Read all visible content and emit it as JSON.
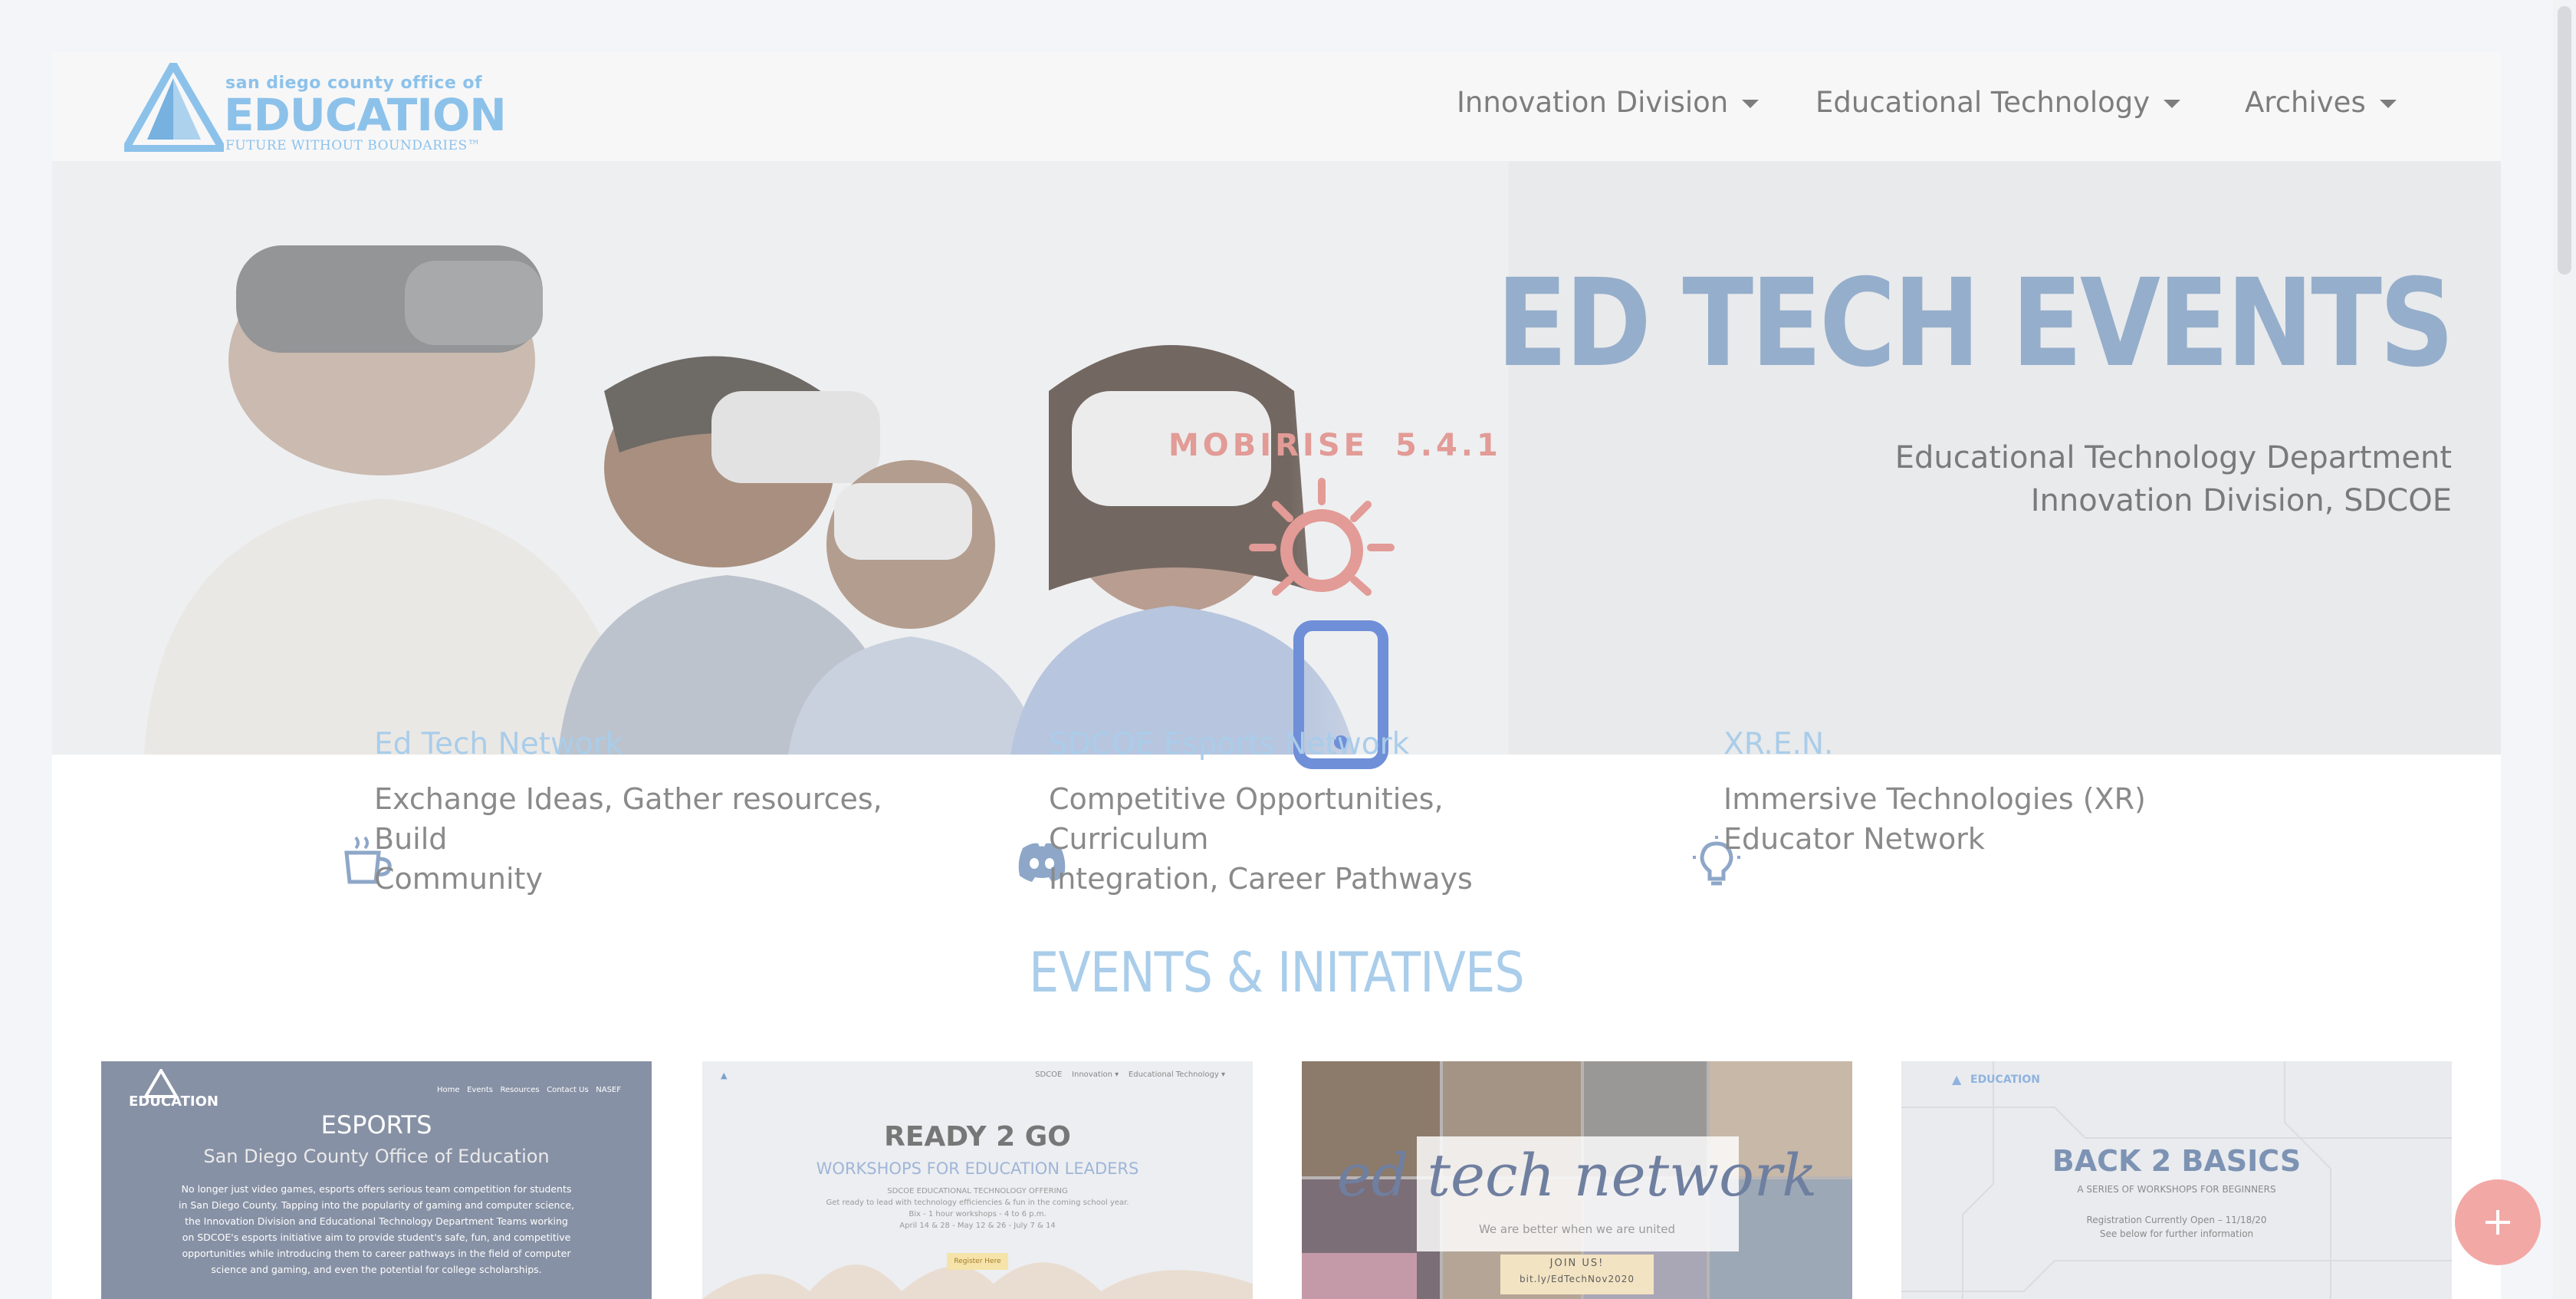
{
  "nav": {
    "logo": {
      "top_line": "san diego county office of",
      "main": "EDUCATION",
      "tagline": "FUTURE WITHOUT BOUNDARIES™"
    },
    "items": [
      {
        "label": "Innovation Division"
      },
      {
        "label": "Educational Technology"
      },
      {
        "label": "Archives"
      }
    ]
  },
  "hero": {
    "title": "ED TECH EVENTS",
    "subtitle_line1": "Educational Technology Department",
    "subtitle_line2": "Innovation Division, SDCOE"
  },
  "overlay": {
    "brand": "MOBIRISE",
    "version": "5.4.1"
  },
  "features": [
    {
      "icon": "coffee-cup-icon",
      "title": "Ed Tech Network",
      "line1": "Exchange Ideas, Gather resources, Build",
      "line2": "Community"
    },
    {
      "icon": "discord-icon",
      "title": "SDCOE Esports Network",
      "line1": "Competitive Opportunities, Curriculum",
      "line2": "Integration, Career Pathways"
    },
    {
      "icon": "lightbulb-icon",
      "title": "XR.E.N.",
      "line1": "Immersive Technologies (XR)",
      "line2": "Educator Network"
    }
  ],
  "section": {
    "title": "EVENTS & INITATIVES"
  },
  "cards": {
    "esports": {
      "logo": "EDUCATION",
      "nav": "Home   Events   Resources   Contact Us   NASEF",
      "heading": "ESPORTS",
      "subheading": "San Diego County Office of Education",
      "body": [
        "No longer just video games, esports offers serious team competition for students",
        "in San Diego County. Tapping into the popularity of gaming and computer science,",
        "the Innovation Division and Educational Technology Department Teams working",
        "on SDCOE's esports initiative aim to provide student's safe, fun, and competitive",
        "opportunities while introducing them to career pathways in the field of computer",
        "science and gaming, and even the potential for college scholarships."
      ]
    },
    "ready2go": {
      "nav": "SDCOE    Innovation ▾    Educational Technology ▾",
      "heading": "READY 2 GO",
      "subheading": "WORKSHOPS FOR EDUCATION LEADERS",
      "line1": "SDCOE EDUCATIONAL TECHNOLOGY OFFERING",
      "line2": "Get ready to lead with technology efficiencies & fun in the coming school year.",
      "line3": "Bix - 1 hour workshops - 4 to 6 p.m.",
      "line4": "April 14 & 28 - May 12 & 26 - July 7 & 14",
      "button": "Register Here"
    },
    "edtech": {
      "title": "ed tech network",
      "tagline": "We are better when we are united",
      "cta": "JOIN US!",
      "link": "bit.ly/EdTechNov2020"
    },
    "b2b": {
      "logo": "EDUCATION",
      "heading": "BACK 2 BASICS",
      "subheading": "A SERIES OF WORKSHOPS FOR BEGINNERS",
      "line1": "Registration Currently Open – 11/18/20",
      "line2": "See below for further information"
    }
  },
  "colors": {
    "accent_light_blue": "#a9cdea",
    "hero_title": "#95aecb",
    "fab": "#f2a9a6"
  }
}
